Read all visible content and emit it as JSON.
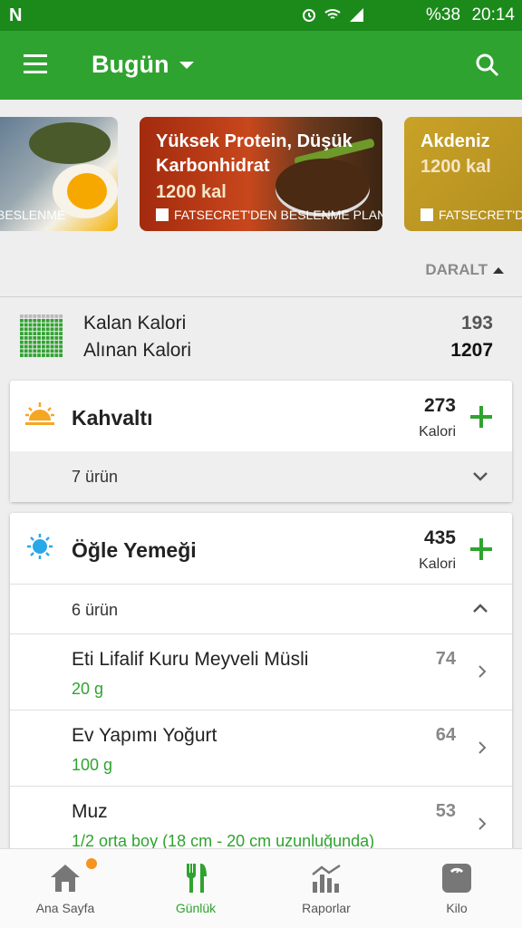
{
  "status_bar": {
    "logo": "N",
    "battery": "%38",
    "time": "20:14"
  },
  "app_bar": {
    "title": "Bugün"
  },
  "carousel": [
    {
      "title": "",
      "kcal": "",
      "footer": "N BESLENME"
    },
    {
      "title": "Yüksek Protein, Düşük Karbonhidrat",
      "kcal": "1200 kal",
      "footer": "FATSECRET'DEN BESLENME PLANI"
    },
    {
      "title": "Akdeniz",
      "kcal": "1200 kal",
      "footer": "FATSECRET'DE"
    }
  ],
  "collapse_label": "DARALT",
  "summary": {
    "remaining_label": "Kalan Kalori",
    "remaining_value": "193",
    "consumed_label": "Alınan Kalori",
    "consumed_value": "1207"
  },
  "meals": [
    {
      "name": "Kahvaltı",
      "calories": "273",
      "cal_label": "Kalori",
      "count": "7 ürün",
      "expanded": false
    },
    {
      "name": "Öğle Yemeği",
      "calories": "435",
      "cal_label": "Kalori",
      "count": "6 ürün",
      "expanded": true,
      "items": [
        {
          "name": "Eti Lifalif Kuru Meyveli Müsli",
          "amount": "20  g",
          "calories": "74"
        },
        {
          "name": "Ev Yapımı Yoğurt",
          "amount": "100  g",
          "calories": "64"
        },
        {
          "name": "Muz",
          "amount": "1/2 orta boy (18 cm - 20 cm uzunluğunda)",
          "calories": "53"
        }
      ]
    }
  ],
  "bottom_nav": [
    {
      "label": "Ana Sayfa",
      "icon": "home-icon",
      "active": false,
      "badge": true
    },
    {
      "label": "Günlük",
      "icon": "fork-knife-icon",
      "active": true,
      "badge": false
    },
    {
      "label": "Raporlar",
      "icon": "reports-chart-icon",
      "active": false,
      "badge": false
    },
    {
      "label": "Kilo",
      "icon": "scale-icon",
      "active": false,
      "badge": false
    }
  ],
  "colors": {
    "primary_green": "#2fa32f",
    "status_green": "#1b8a1b",
    "badge_orange": "#f5941e"
  }
}
